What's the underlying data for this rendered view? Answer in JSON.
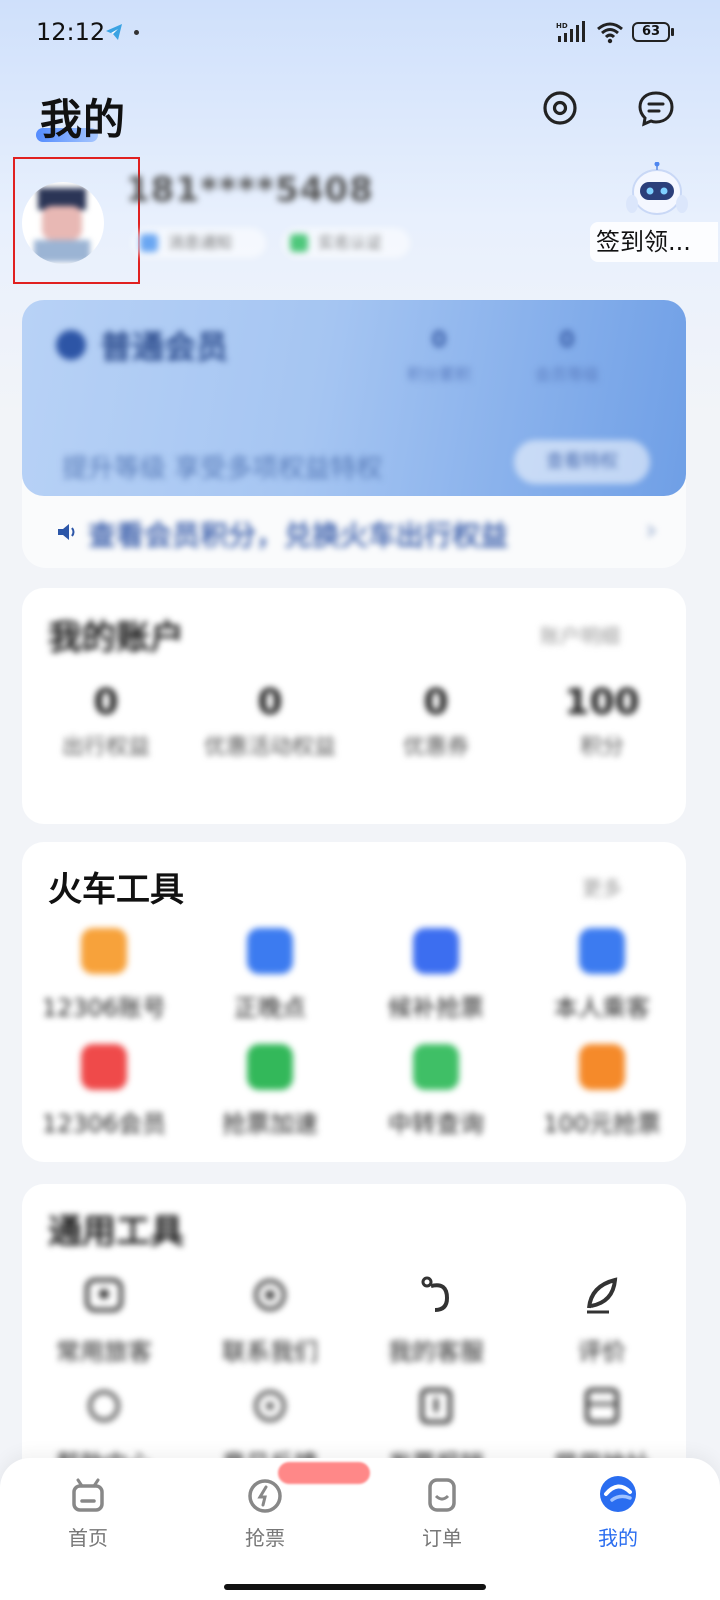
{
  "status_bar": {
    "time": "12:12",
    "battery": "63"
  },
  "header": {
    "title": "我的"
  },
  "profile": {
    "phone": "181****5408",
    "tags": [
      "消息通知",
      "实名认证"
    ],
    "signin_label": "签到领..."
  },
  "member": {
    "title": "普通会员",
    "stats": [
      {
        "value": "0",
        "label": "积分累积"
      },
      {
        "value": "0",
        "label": "会员等级"
      }
    ],
    "description": "提升等级 享受多项权益特权",
    "button": "查看特权",
    "notice": "查看会员积分，兑换火车出行权益"
  },
  "account": {
    "title": "我的账户",
    "link": "账户明细",
    "items": [
      {
        "value": "0",
        "label": "出行权益"
      },
      {
        "value": "0",
        "label": "优惠活动权益"
      },
      {
        "value": "0",
        "label": "优惠券"
      },
      {
        "value": "100",
        "label": "积分"
      }
    ]
  },
  "train_tools": {
    "title": "火车工具",
    "link": "更多",
    "items": [
      {
        "label": "12306账号",
        "icon": "train-icon",
        "color": "#f7a23b"
      },
      {
        "label": "正晚点",
        "icon": "clock-icon",
        "color": "#3c7bf0"
      },
      {
        "label": "候补抢票",
        "icon": "alert-icon",
        "color": "#3c6ef0"
      },
      {
        "label": "本人乘客",
        "icon": "passenger-icon",
        "color": "#3c7bf0"
      },
      {
        "label": "12306会员",
        "icon": "vip-icon",
        "color": "#ef4a4a"
      },
      {
        "label": "抢票加速",
        "icon": "speed-icon",
        "color": "#33b85a"
      },
      {
        "label": "中转查询",
        "icon": "transfer-icon",
        "color": "#3fbf66"
      },
      {
        "label": "100元抢票",
        "icon": "ticket-icon",
        "color": "#f58a2a"
      }
    ]
  },
  "common_tools": {
    "title": "通用工具",
    "items": [
      {
        "label": "常用旅客",
        "icon": "contact-icon"
      },
      {
        "label": "联系我们",
        "icon": "service-icon"
      },
      {
        "label": "我的客服",
        "icon": "support-icon"
      },
      {
        "label": "评价",
        "icon": "feedback-icon"
      },
      {
        "label": "帮助中心",
        "icon": "help-icon"
      },
      {
        "label": "意见反馈",
        "icon": "settings-icon"
      },
      {
        "label": "发票报销",
        "icon": "invoice-icon"
      },
      {
        "label": "常用地址",
        "icon": "address-icon"
      }
    ]
  },
  "bottom_nav": {
    "items": [
      {
        "label": "首页"
      },
      {
        "label": "抢票"
      },
      {
        "label": "订单"
      },
      {
        "label": "我的"
      }
    ],
    "active_index": 3
  },
  "colors": {
    "accent": "#2a6df0",
    "member_card": "#a5c5f2"
  }
}
